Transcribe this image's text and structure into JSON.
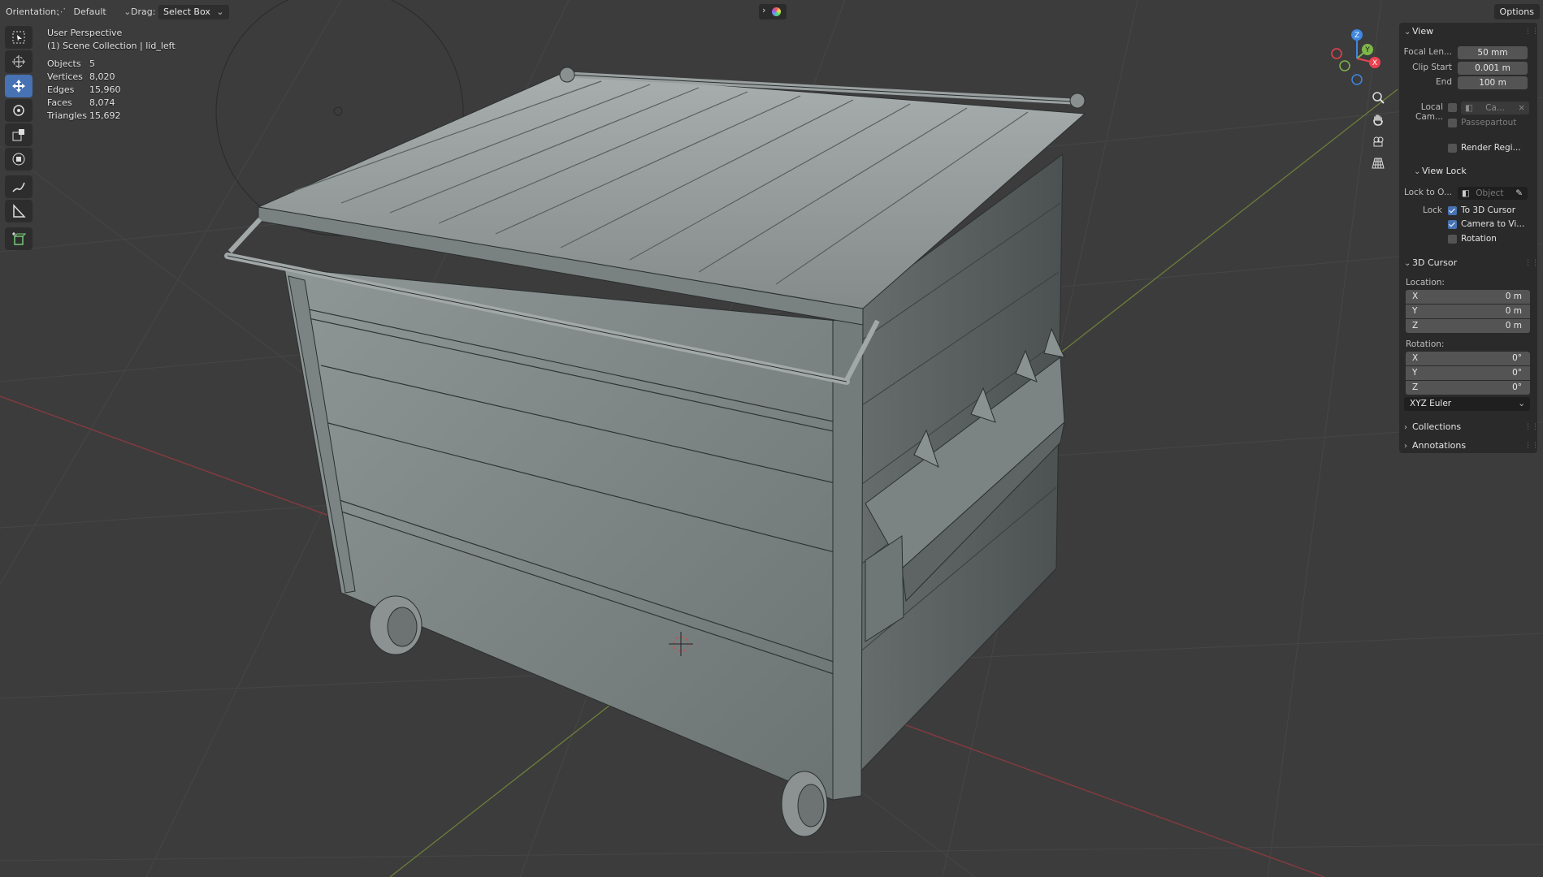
{
  "header": {
    "orientation_label": "Orientation:",
    "orientation_value": "Default",
    "drag_label": "Drag:",
    "drag_value": "Select Box",
    "options_label": "Options"
  },
  "toolbar": {
    "tools": [
      "select-box",
      "cursor",
      "move",
      "rotate",
      "scale",
      "transform",
      "annotate",
      "measure",
      "add-cube"
    ],
    "active_tool": "move"
  },
  "overlay": {
    "view_name": "User Perspective",
    "collection": "(1) Scene Collection | lid_left",
    "stats": [
      {
        "label": "Objects",
        "value": "5"
      },
      {
        "label": "Vertices",
        "value": "8,020"
      },
      {
        "label": "Edges",
        "value": "15,960"
      },
      {
        "label": "Faces",
        "value": "8,074"
      },
      {
        "label": "Triangles",
        "value": "15,692"
      }
    ]
  },
  "gizmo": {
    "z": "Z",
    "y": "Y",
    "x": "X",
    "x_color": "#e8434f",
    "y_color": "#7fb64a",
    "z_color": "#3f87e2"
  },
  "npanel": {
    "view": {
      "title": "View",
      "focal_length_label": "Focal Len...",
      "focal_length_value": "50 mm",
      "clip_start_label": "Clip Start",
      "clip_start_value": "0.001 m",
      "clip_end_label": "End",
      "clip_end_value": "100 m",
      "local_camera_label": "Local Cam...",
      "local_camera_value": "Ca...",
      "passepartout_label": "Passepartout",
      "render_region_label": "Render Regi..."
    },
    "view_lock": {
      "title": "View Lock",
      "lock_to_object_label": "Lock to O...",
      "lock_to_object_placeholder": "Object",
      "lock_label": "Lock",
      "to_3d_cursor_label": "To 3D Cursor",
      "to_3d_cursor_checked": true,
      "camera_to_view_label": "Camera to Vi...",
      "camera_to_view_checked": true,
      "rotation_label": "Rotation",
      "rotation_checked": false
    },
    "cursor": {
      "title": "3D Cursor",
      "location_label": "Location:",
      "location": [
        {
          "axis": "X",
          "value": "0 m"
        },
        {
          "axis": "Y",
          "value": "0 m"
        },
        {
          "axis": "Z",
          "value": "0 m"
        }
      ],
      "rotation_label": "Rotation:",
      "rotation": [
        {
          "axis": "X",
          "value": "0°"
        },
        {
          "axis": "Y",
          "value": "0°"
        },
        {
          "axis": "Z",
          "value": "0°"
        }
      ],
      "rotation_mode": "XYZ Euler"
    },
    "collections_title": "Collections",
    "annotations_title": "Annotations"
  }
}
